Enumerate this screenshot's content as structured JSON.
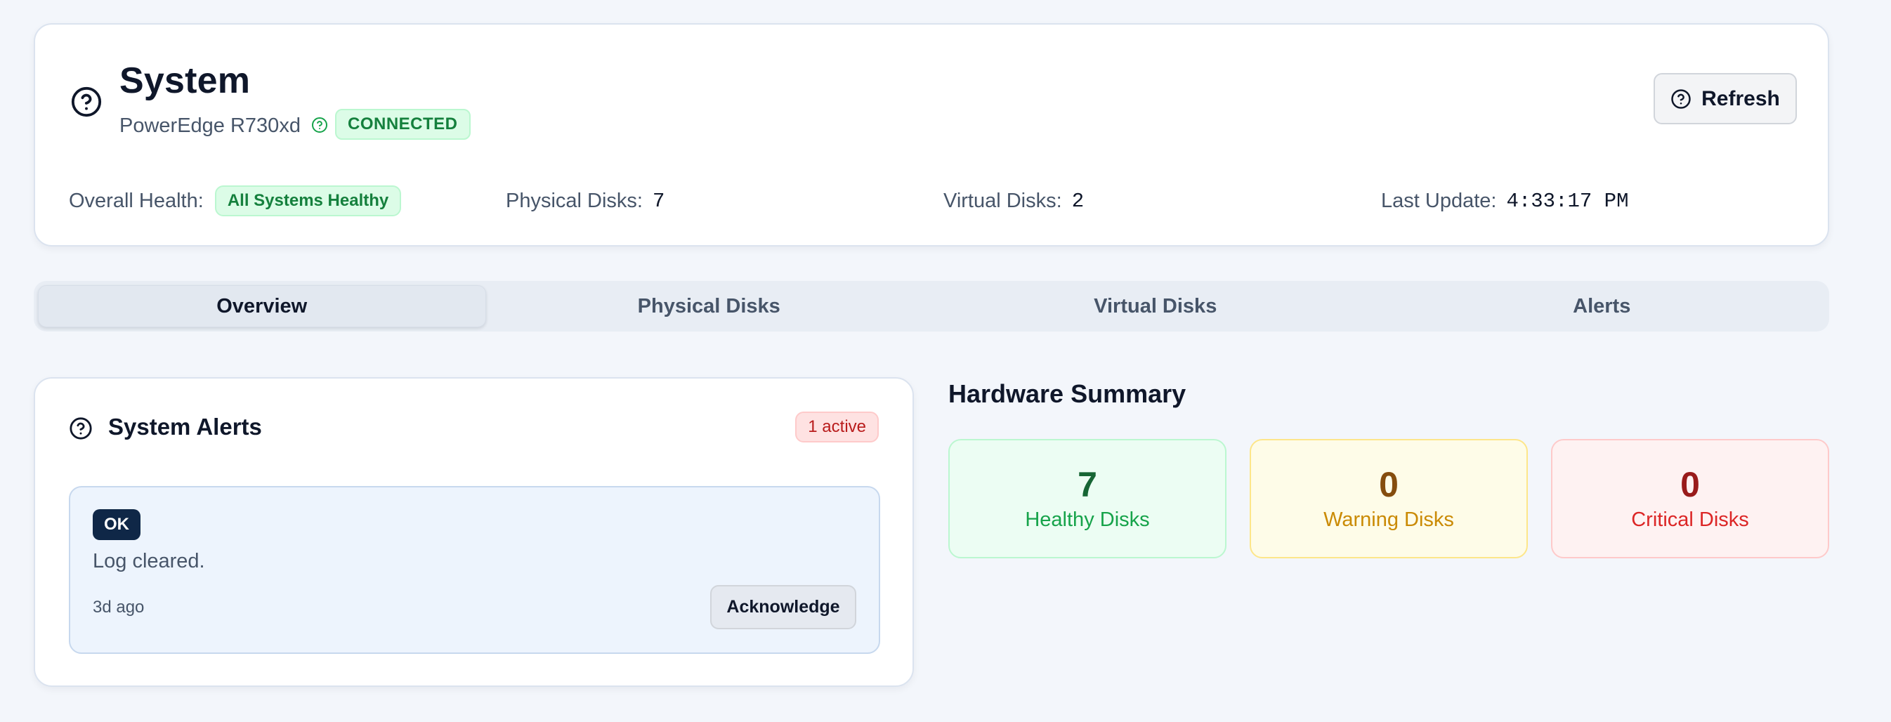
{
  "header": {
    "title": "System",
    "model": "PowerEdge R730xd",
    "connection_status": "CONNECTED",
    "refresh_label": "Refresh",
    "icon": "help-circle-icon"
  },
  "stats": {
    "overall_health_label": "Overall Health:",
    "overall_health_value": "All Systems Healthy",
    "physical_disks_label": "Physical Disks:",
    "physical_disks_value": "7",
    "virtual_disks_label": "Virtual Disks:",
    "virtual_disks_value": "2",
    "last_update_label": "Last Update:",
    "last_update_value": "4:33:17 PM"
  },
  "tabs": [
    {
      "label": "Overview",
      "active": true
    },
    {
      "label": "Physical Disks",
      "active": false
    },
    {
      "label": "Virtual Disks",
      "active": false
    },
    {
      "label": "Alerts",
      "active": false
    }
  ],
  "alerts": {
    "title": "System Alerts",
    "active_count": "1 active",
    "items": [
      {
        "severity": "OK",
        "message": "Log cleared.",
        "time": "3d ago",
        "action_label": "Acknowledge"
      }
    ]
  },
  "hardware_summary": {
    "title": "Hardware Summary",
    "healthy": {
      "value": "7",
      "label": "Healthy Disks"
    },
    "warning": {
      "value": "0",
      "label": "Warning Disks"
    },
    "critical": {
      "value": "0",
      "label": "Critical Disks"
    }
  },
  "colors": {
    "background": "#f3f6fb",
    "healthy_green": "#16a34a",
    "warning_amber": "#ca8a04",
    "critical_red": "#dc2626",
    "ok_badge_navy": "#0f2747"
  }
}
